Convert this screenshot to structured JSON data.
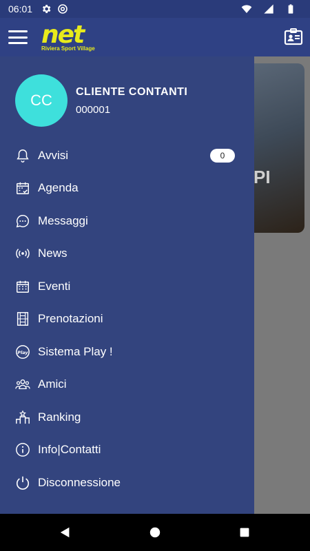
{
  "status_bar": {
    "time": "06:01"
  },
  "app_bar": {
    "logo_word": "net",
    "logo_sub": "Riviera Sport Village"
  },
  "hero": {
    "text": "PI"
  },
  "profile": {
    "initials": "CC",
    "name": "CLIENTE CONTANTI",
    "code": "000001"
  },
  "menu": [
    {
      "label": "Avvisi",
      "icon": "bell-icon",
      "badge": "0"
    },
    {
      "label": "Agenda",
      "icon": "calendar-check-icon"
    },
    {
      "label": "Messaggi",
      "icon": "chat-bubble-icon"
    },
    {
      "label": "News",
      "icon": "broadcast-icon"
    },
    {
      "label": "Eventi",
      "icon": "calendar-grid-icon"
    },
    {
      "label": "Prenotazioni",
      "icon": "court-icon"
    },
    {
      "label": "Sistema Play !",
      "icon": "play-badge-icon"
    },
    {
      "label": "Amici",
      "icon": "group-icon"
    },
    {
      "label": "Ranking",
      "icon": "podium-icon"
    },
    {
      "label": "Info|Contatti",
      "icon": "info-icon"
    },
    {
      "label": "Disconnessione",
      "icon": "power-icon"
    }
  ],
  "colors": {
    "drawer": "#33447e",
    "app_bar": "#2f4184",
    "accent": "#e8ea1c",
    "avatar": "#3ee0dc"
  }
}
